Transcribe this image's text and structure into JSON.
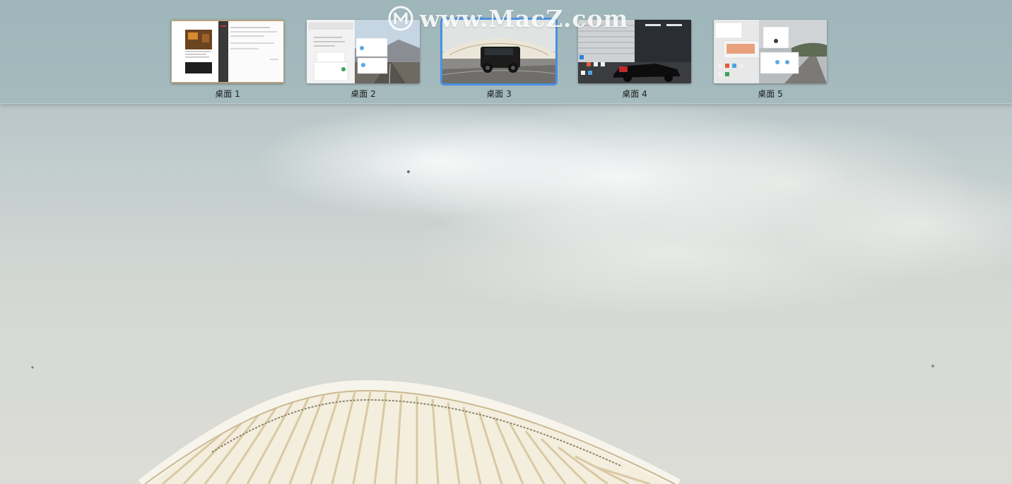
{
  "mission_control": {
    "spaces": [
      {
        "label": "桌面 1",
        "active": false,
        "wallpaper": "document-window"
      },
      {
        "label": "桌面 2",
        "active": false,
        "wallpaper": "mountain-road"
      },
      {
        "label": "桌面 3",
        "active": true,
        "wallpaper": "black-suv-road"
      },
      {
        "label": "桌面 4",
        "active": false,
        "wallpaper": "garage-sports-car"
      },
      {
        "label": "桌面 5",
        "active": false,
        "wallpaper": "road-with-windows"
      }
    ]
  },
  "watermark": {
    "text": "www.MacZ.com",
    "icon": "macz-logo-icon"
  },
  "colors": {
    "accent": "#4a90e2",
    "bar_tint": "#96b0b4",
    "label_text": "#1d1d1d"
  }
}
